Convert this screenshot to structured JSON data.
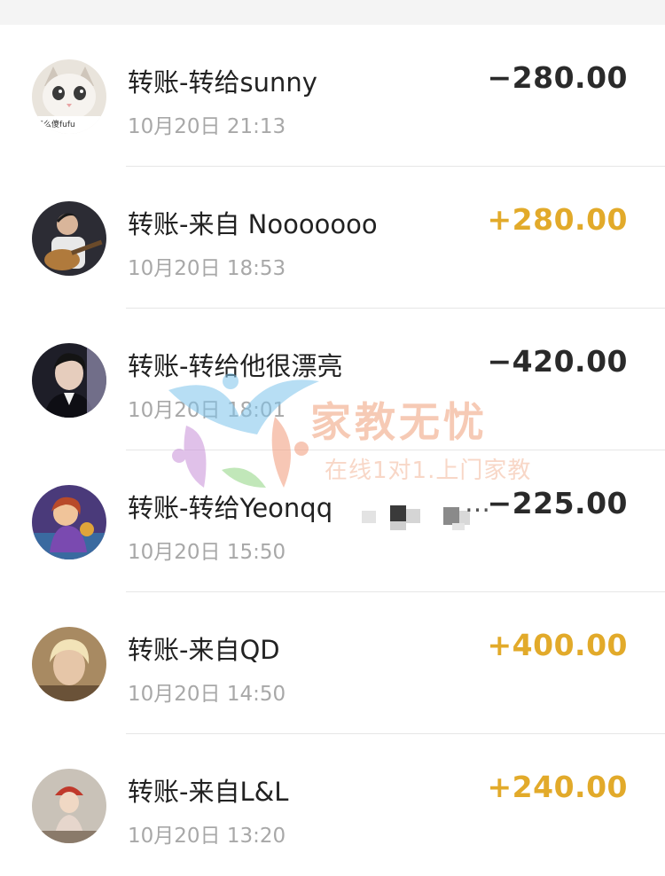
{
  "transactions": [
    {
      "title": "转账-转给sunny",
      "time": "10月20日 21:13",
      "amount": "−280.00",
      "direction": "out",
      "avatar_text": "怎么傻fufu"
    },
    {
      "title": "转账-来自 Nooooooo",
      "time": "10月20日 18:53",
      "amount": "+280.00",
      "direction": "in"
    },
    {
      "title": "转账-转给他很漂亮",
      "time": "10月20日 18:01",
      "amount": "−420.00",
      "direction": "out"
    },
    {
      "title": "转账-转给Yeonqq",
      "title_suffix": "…",
      "time": "10月20日 15:50",
      "amount": "−225.00",
      "direction": "out"
    },
    {
      "title": "转账-来自QD",
      "time": "10月20日 14:50",
      "amount": "+400.00",
      "direction": "in"
    },
    {
      "title": "转账-来自L&L",
      "time": "10月20日 13:20",
      "amount": "+240.00",
      "direction": "in"
    }
  ],
  "watermark": {
    "title": "家教无忧",
    "subtitle": "在线1对1.上门家教"
  },
  "colors": {
    "income": "#e2aa2a",
    "expense": "#2a2a2a",
    "secondary_text": "#a8a8a8"
  }
}
